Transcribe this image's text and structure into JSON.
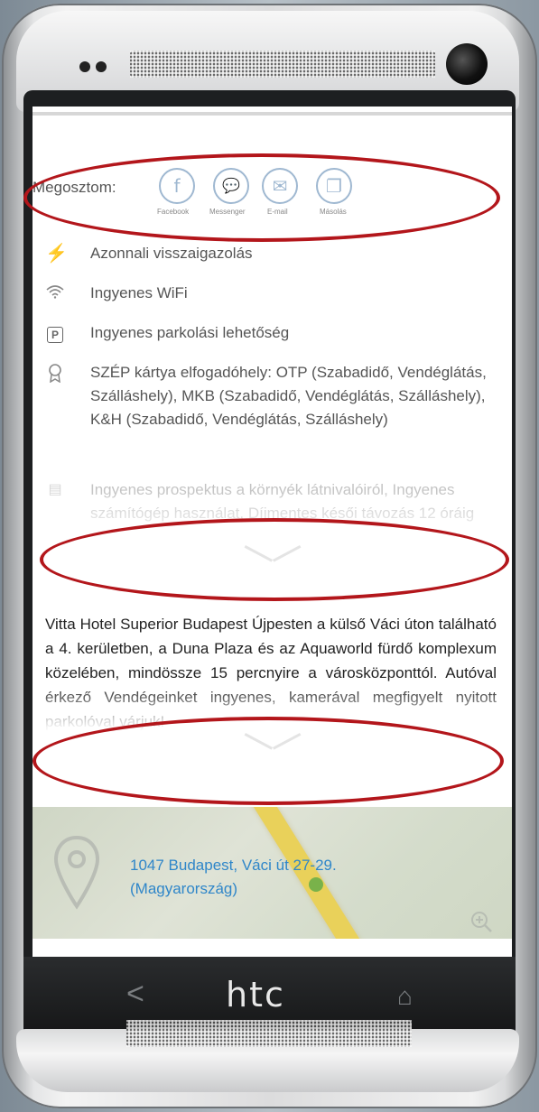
{
  "device": {
    "brand": "htc",
    "nav_back": "<",
    "nav_home": "⌂"
  },
  "share": {
    "label": "Megosztom:",
    "buttons": [
      {
        "icon": "facebook-icon",
        "glyph": "f",
        "caption": "Facebook"
      },
      {
        "icon": "messenger-icon",
        "glyph": "💬",
        "caption": "Messenger"
      },
      {
        "icon": "email-icon",
        "glyph": "✉",
        "caption": "E-mail"
      },
      {
        "icon": "copy-icon",
        "glyph": "❐",
        "caption": "Másolás"
      }
    ]
  },
  "features": [
    {
      "icon": "lightning-icon",
      "text": "Azonnali visszaigazolás"
    },
    {
      "icon": "wifi-icon",
      "text": "Ingyenes WiFi"
    },
    {
      "icon": "parking-icon",
      "text": "Ingyenes parkolási lehetőség"
    },
    {
      "icon": "szep-card-icon",
      "text": "SZÉP kártya elfogadóhely: OTP (Szabadidő, Vendéglátás, Szálláshely), MKB (Szabadidő, Vendéglátás, Szálláshely), K&H (Szabadidő, Vendéglátás, Szálláshely)"
    },
    {
      "icon": "brochure-icon",
      "text": "Ingyenes prospektus a környék látnivalóiról, Ingyenes számítógép használat, Díjmentes késői távozás 12 óráig"
    }
  ],
  "description": "Vitta Hotel Superior Budapest Újpesten a külső Váci úton található a 4. kerületben, a Duna Plaza és az Aquaworld fürdő komplexum közelében, mindössze 15 percnyire a városközponttól. Autóval érkező Vendégeinket ingyenes, kamerával megfigyelt nyitott parkolóval várjuk!",
  "map": {
    "address_line1": "1047 Budapest, Váci út 27-29.",
    "address_line2": "(Magyarország)"
  },
  "colors": {
    "annotation_ellipse": "#b3161b",
    "link": "#2f86c9",
    "accent_bolt": "#f1a21f"
  }
}
